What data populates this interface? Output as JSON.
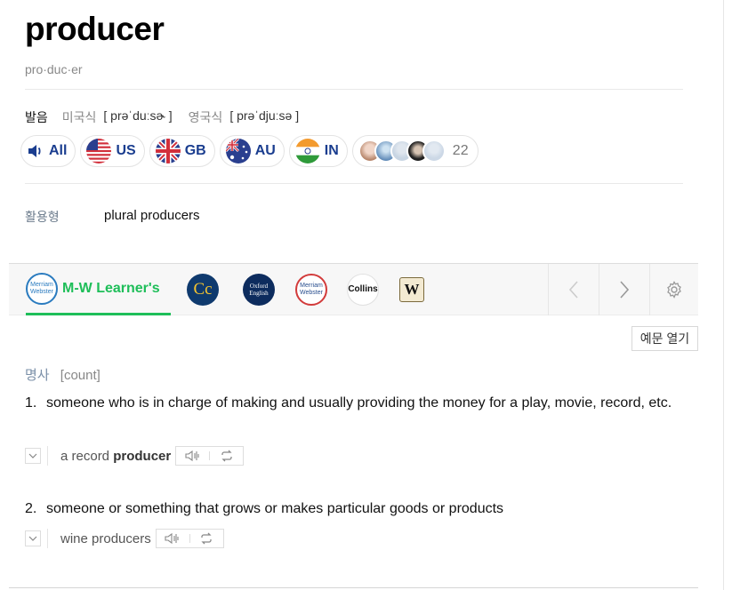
{
  "entry": {
    "headword": "producer",
    "syllabification": "pro·duc·er"
  },
  "pronunciation": {
    "label": "발음",
    "us_label": "미국식",
    "us_ipa": "[ prəˈduːsɚ ]",
    "uk_label": "영국식",
    "uk_ipa": "[ prəˈdjuːsə ]",
    "buttons": [
      "All",
      "US",
      "GB",
      "AU",
      "IN"
    ],
    "user_count": "22"
  },
  "inflection": {
    "label": "활용형",
    "value": "plural producers"
  },
  "dictionaries": {
    "active": "M-W Learner's",
    "logos": {
      "mw_learners": "Merriam Webster",
      "collins": "Collins",
      "cambridge": "Cc",
      "oxford": "Oxford English",
      "merriam_webster": "Merriam Webster",
      "wiktionary": "W"
    }
  },
  "example_toggle": "예문 열기",
  "part_of_speech": {
    "pos": "명사",
    "grammar": "[count]"
  },
  "senses": [
    {
      "num": "1.",
      "definition": "someone who is in charge of making and usually providing the money for a play, movie, record, etc.",
      "example_pre": "a record ",
      "example_bold": "producer",
      "example_post": ""
    },
    {
      "num": "2.",
      "definition": "someone or something that grows or makes particular goods or products",
      "example_pre": "wine producers",
      "example_bold": "",
      "example_post": ""
    }
  ],
  "colors": {
    "accent": "#1ebe59",
    "pron_text": "#1a3d8f"
  },
  "icons": {
    "speaker": "speaker-icon",
    "flags": [
      "us-flag-icon",
      "uk-flag-icon",
      "au-flag-icon",
      "in-flag-icon"
    ],
    "nav": [
      "chevron-left-icon",
      "chevron-right-icon",
      "gear-icon"
    ],
    "example": [
      "chevron-down-icon",
      "audio-wave-icon",
      "repeat-icon"
    ]
  }
}
